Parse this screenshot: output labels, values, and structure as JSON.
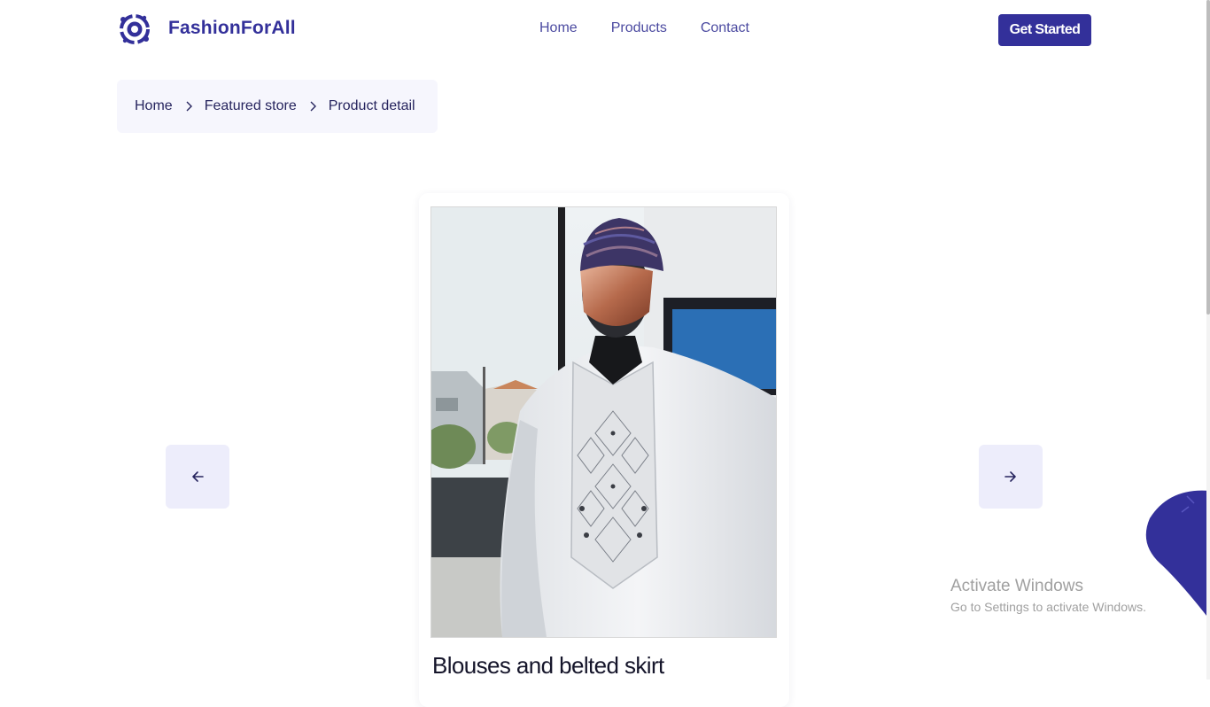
{
  "header": {
    "brand_name": "FashionForAll",
    "nav": [
      "Home",
      "Products",
      "Contact"
    ],
    "cta_label": "Get Started",
    "logo_icon": "orbit-logo-icon",
    "brand_color": "#33309a"
  },
  "breadcrumb": {
    "items": [
      "Home",
      "Featured store",
      "Product detail"
    ],
    "separator_icon": "chevron-right-icon"
  },
  "product": {
    "title": "Blouses and belted skirt",
    "image": "white-embroidered-agbada-on-mannequin"
  },
  "carousel": {
    "prev_icon": "arrow-left-icon",
    "next_icon": "arrow-right-icon"
  },
  "watermark": {
    "title": "Activate Windows",
    "subtitle": "Go to Settings to activate Windows."
  }
}
